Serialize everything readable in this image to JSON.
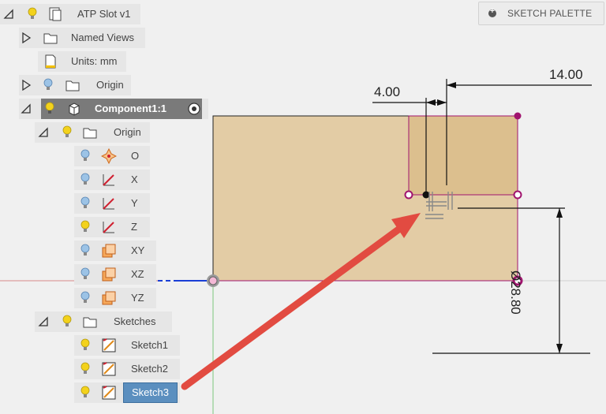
{
  "browser": {
    "root": {
      "label": "ATP Slot v1"
    },
    "named_views": {
      "label": "Named Views"
    },
    "units": {
      "label": "Units: mm"
    },
    "origin_top": {
      "label": "Origin"
    },
    "component": {
      "label": "Component1:1"
    },
    "origin_comp": {
      "label": "Origin"
    },
    "origin_items": [
      {
        "label": "O",
        "bulb": "blue"
      },
      {
        "label": "X",
        "bulb": "blue"
      },
      {
        "label": "Y",
        "bulb": "blue"
      },
      {
        "label": "Z",
        "bulb": "yellow"
      },
      {
        "label": "XY",
        "bulb": "blue"
      },
      {
        "label": "XZ",
        "bulb": "blue"
      },
      {
        "label": "YZ",
        "bulb": "blue"
      }
    ],
    "sketches": {
      "label": "Sketches"
    },
    "sketch_items": [
      {
        "label": "Sketch1"
      },
      {
        "label": "Sketch2"
      },
      {
        "label": "Sketch3",
        "selected": true
      }
    ]
  },
  "sketch_palette": {
    "label": "SKETCH PALETTE"
  },
  "dimensions": {
    "d1": "14.00",
    "d2": "4.00",
    "d3": "Ø28.80"
  },
  "colors": {
    "profile": "#e3cca5",
    "slot": "#dcbf8e",
    "constraint_magenta": "#a0136e",
    "arrow": "#e24b41",
    "bulb_yellow": "#f3d21c",
    "bulb_blue": "#9cc3e6",
    "selected": "#5b8fbf"
  },
  "icons": [
    "bulb-icon",
    "folder-icon",
    "document-icon",
    "cube-icon",
    "origin-point-icon",
    "axis-icon",
    "plane-icon",
    "sketch-icon",
    "radio-icon",
    "triangle-expand-icon"
  ]
}
